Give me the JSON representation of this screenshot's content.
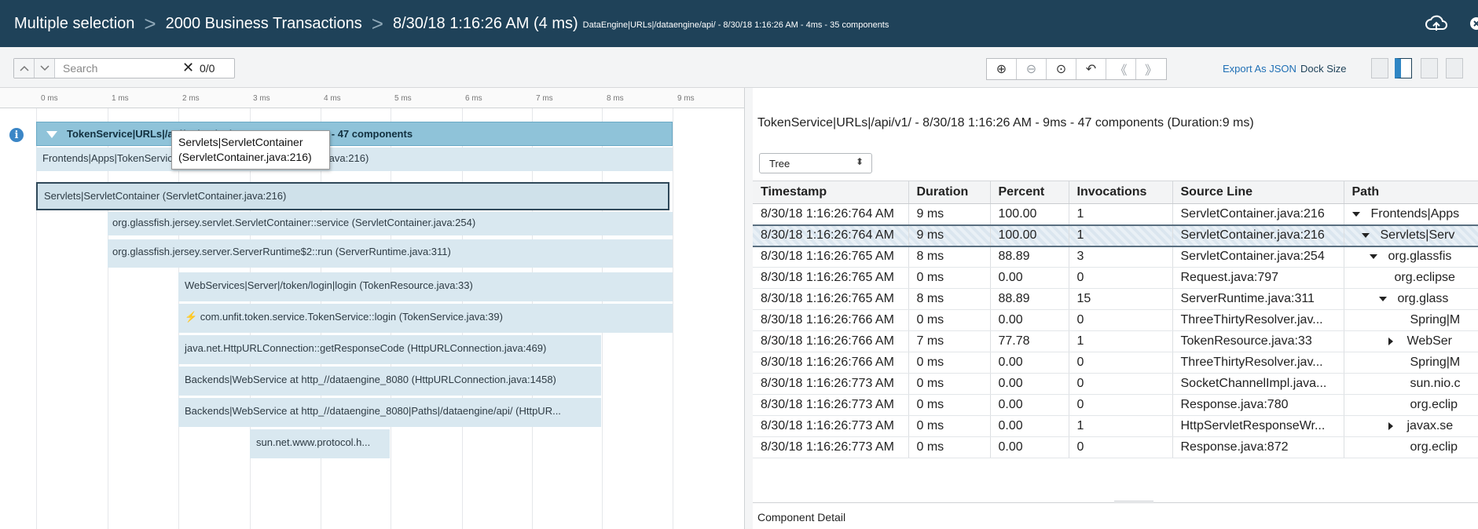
{
  "title_bar": {
    "crumbs": [
      "Multiple selection",
      "2000 Business Transactions",
      "8/30/18 1:16:26 AM (4 ms)"
    ],
    "crumb_detail": "DataEngine|URLs|/dataengine/api/ - 8/30/18 1:16:26 AM - 4ms - 35 components",
    "separator": ">"
  },
  "toolbar": {
    "search_placeholder": "Search",
    "search_clear": "✕",
    "match_count": "0/0",
    "tools": [
      "zoom-in-icon",
      "zoom-out-icon",
      "crosshair-icon",
      "undo-icon",
      "first-page-icon",
      "last-page-icon"
    ],
    "tool_glyphs": [
      "⊕",
      "⊖",
      "⊙",
      "↶",
      "《",
      "》"
    ],
    "export_label": "Export As JSON",
    "dock_size_label": "Dock Size"
  },
  "timeline": {
    "ticks": [
      "0 ms",
      "1 ms",
      "2 ms",
      "3 ms",
      "4 ms",
      "5 ms",
      "6 ms",
      "7 ms",
      "8 ms",
      "9 ms"
    ],
    "root_label": "TokenService|URLs|/api/v1/ - 8/30/18 1:16:26 AM - 9ms - 47 components",
    "bars": [
      "Frontends|Apps|TokenService|URLs|/api/v1/ (ServletContainer.java:216)",
      "Servlets|ServletContainer (ServletContainer.java:216)",
      "org.glassfish.jersey.servlet.ServletContainer::service (ServletContainer.java:254)",
      "org.glassfish.jersey.server.ServerRuntime$2::run (ServerRuntime.java:311)",
      "WebServices|Server|/token/login|login (TokenResource.java:33)",
      "⚡ com.unfit.token.service.TokenService::login (TokenService.java:39)",
      "java.net.HttpURLConnection::getResponseCode (HttpURLConnection.java:469)",
      "Backends|WebService at http_//dataengine_8080 (HttpURLConnection.java:1458)",
      "Backends|WebService at http_//dataengine_8080|Paths|/dataengine/api/ (HttpUR...",
      "sun.net.www.protocol.h..."
    ],
    "tooltip_line1": "Servlets|ServletContainer",
    "tooltip_line2": "(ServletContainer.java:216)"
  },
  "detail": {
    "title": "TokenService|URLs|/api/v1/ - 8/30/18 1:16:26 AM - 9ms - 47 components (Duration:9 ms)",
    "view_select": "Tree",
    "columns": [
      "Timestamp",
      "Duration",
      "Percent",
      "Invocations",
      "Source Line",
      "Path"
    ],
    "rows": [
      {
        "timestamp": "8/30/18 1:16:26:764 AM",
        "duration": "9 ms",
        "percent": "100.00",
        "invocations": "1",
        "source": "ServletContainer.java:216",
        "path": "Frontends|Apps"
      },
      {
        "timestamp": "8/30/18 1:16:26:764 AM",
        "duration": "9 ms",
        "percent": "100.00",
        "invocations": "1",
        "source": "ServletContainer.java:216",
        "path": "Servlets|Serv"
      },
      {
        "timestamp": "8/30/18 1:16:26:765 AM",
        "duration": "8 ms",
        "percent": "88.89",
        "invocations": "3",
        "source": "ServletContainer.java:254",
        "path": "org.glassfis"
      },
      {
        "timestamp": "8/30/18 1:16:26:765 AM",
        "duration": "0 ms",
        "percent": "0.00",
        "invocations": "0",
        "source": "Request.java:797",
        "path": "org.eclipse"
      },
      {
        "timestamp": "8/30/18 1:16:26:765 AM",
        "duration": "8 ms",
        "percent": "88.89",
        "invocations": "15",
        "source": "ServerRuntime.java:311",
        "path": "org.glass"
      },
      {
        "timestamp": "8/30/18 1:16:26:766 AM",
        "duration": "0 ms",
        "percent": "0.00",
        "invocations": "0",
        "source": "ThreeThirtyResolver.jav...",
        "path": "Spring|M"
      },
      {
        "timestamp": "8/30/18 1:16:26:766 AM",
        "duration": "7 ms",
        "percent": "77.78",
        "invocations": "1",
        "source": "TokenResource.java:33",
        "path": "WebSer"
      },
      {
        "timestamp": "8/30/18 1:16:26:766 AM",
        "duration": "0 ms",
        "percent": "0.00",
        "invocations": "0",
        "source": "ThreeThirtyResolver.jav...",
        "path": "Spring|M"
      },
      {
        "timestamp": "8/30/18 1:16:26:773 AM",
        "duration": "0 ms",
        "percent": "0.00",
        "invocations": "0",
        "source": "SocketChannelImpl.java...",
        "path": "sun.nio.c"
      },
      {
        "timestamp": "8/30/18 1:16:26:773 AM",
        "duration": "0 ms",
        "percent": "0.00",
        "invocations": "0",
        "source": "Response.java:780",
        "path": "org.eclip"
      },
      {
        "timestamp": "8/30/18 1:16:26:773 AM",
        "duration": "0 ms",
        "percent": "0.00",
        "invocations": "1",
        "source": "HttpServletResponseWr...",
        "path": "javax.se"
      },
      {
        "timestamp": "8/30/18 1:16:26:773 AM",
        "duration": "0 ms",
        "percent": "0.00",
        "invocations": "0",
        "source": "Response.java:872",
        "path": "org.eclip"
      }
    ],
    "component_detail_label": "Component Detail"
  },
  "colors": {
    "title_bar": "#1f4259",
    "root_bar": "#8fc3d9",
    "bar": "#d9e8f0",
    "link": "#1f6fb5",
    "info_icon": "#3b86c6"
  }
}
